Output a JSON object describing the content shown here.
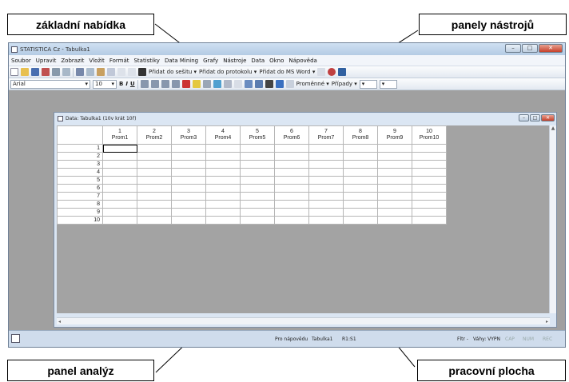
{
  "annotations": {
    "menu": "základní nabídka",
    "toolbars": "panely nástrojů",
    "analysis_bar": "panel analýz",
    "workspace": "pracovní plocha"
  },
  "app": {
    "title": "STATISTICA Cz - Tabulka1",
    "controls": [
      "–",
      "□",
      "✕"
    ]
  },
  "menu": [
    "Soubor",
    "Upravit",
    "Zobrazit",
    "Vložit",
    "Formát",
    "Statistiky",
    "Data Mining",
    "Grafy",
    "Nástroje",
    "Data",
    "Okno",
    "Nápověda"
  ],
  "toolbar1": {
    "buttons": [
      "Přidat do sešitu ▾",
      "Přidat do protokolu ▾",
      "Přidat do MS Word ▾"
    ]
  },
  "toolbar2": {
    "font": "Arial",
    "size": "10",
    "format": [
      "B",
      "I",
      "U"
    ],
    "buttons": [
      "Proměnné ▾",
      "Případy ▾"
    ]
  },
  "document": {
    "title": "Data: Tabulka1 (10v krát 10ř)"
  },
  "grid": {
    "columns": [
      {
        "num": "1",
        "name": "Prom1"
      },
      {
        "num": "2",
        "name": "Prom2"
      },
      {
        "num": "3",
        "name": "Prom3"
      },
      {
        "num": "4",
        "name": "Prom4"
      },
      {
        "num": "5",
        "name": "Prom5"
      },
      {
        "num": "6",
        "name": "Prom6"
      },
      {
        "num": "7",
        "name": "Prom7"
      },
      {
        "num": "8",
        "name": "Prom8"
      },
      {
        "num": "9",
        "name": "Prom9"
      },
      {
        "num": "10",
        "name": "Prom10"
      }
    ],
    "rows": [
      "1",
      "2",
      "3",
      "4",
      "5",
      "6",
      "7",
      "8",
      "9",
      "10"
    ]
  },
  "status": {
    "help": "Pro nápovědu",
    "sheet": "Tabulka1",
    "cell": "R1:S1",
    "filter": "Fltr -",
    "weights": "Váhy: VYPN",
    "cap": "CAP",
    "num": "NUM",
    "rec": "REC"
  }
}
